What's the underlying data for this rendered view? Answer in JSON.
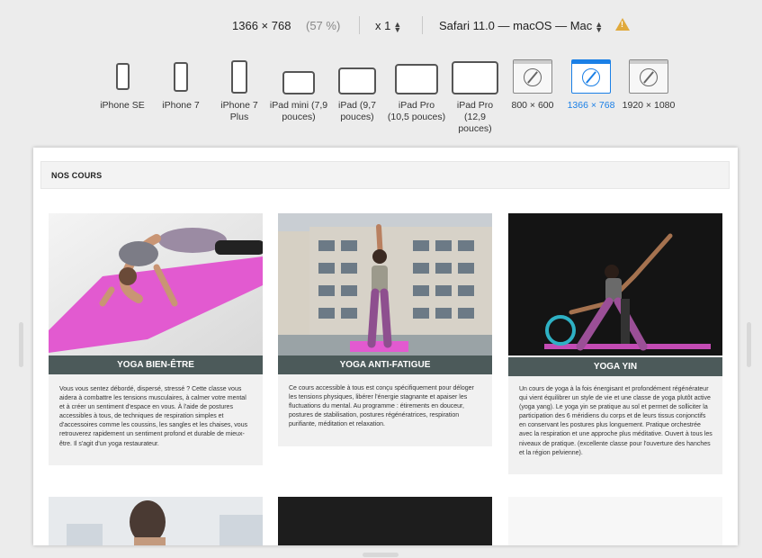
{
  "toolbar": {
    "dimensions": "1366 × 768",
    "percent": "(57 %)",
    "scale": "x 1",
    "browser": "Safari 11.0 — macOS — Mac"
  },
  "devices": [
    {
      "label": "iPhone SE",
      "icon": "phone-icon"
    },
    {
      "label": "iPhone 7",
      "icon": "phone-icon"
    },
    {
      "label": "iPhone 7 Plus",
      "icon": "phone-icon"
    },
    {
      "label": "iPad mini (7,9 pouces)",
      "icon": "tablet-icon"
    },
    {
      "label": "iPad (9,7 pouces)",
      "icon": "tablet-icon"
    },
    {
      "label": "iPad Pro (10,5 pouces)",
      "icon": "tablet-icon"
    },
    {
      "label": "iPad Pro (12,9 pouces)",
      "icon": "tablet-icon"
    },
    {
      "label": "800 × 600",
      "icon": "safari-compass-icon"
    },
    {
      "label": "1366 × 768",
      "icon": "safari-compass-icon",
      "active": true
    },
    {
      "label": "1920 × 1080",
      "icon": "safari-compass-icon"
    }
  ],
  "page": {
    "section_title": "NOS COURS",
    "cards": [
      {
        "title": "YOGA BIEN-ÊTRE",
        "text": "Vous vous sentez débordé, dispersé, stressé ? Cette classe vous aidera à combattre les tensions musculaires, à calmer votre mental et à créer un sentiment d'espace en vous. À l'aide de postures accessibles à tous, de techniques de respiration simples et d'accessoires comme les coussins, les sangles et les chaises, vous retrouverez rapidement un sentiment profond et durable de mieux- être. Il s'agit d'un yoga restaurateur."
      },
      {
        "title": "YOGA ANTI-FATIGUE",
        "text": "Ce cours accessible à tous est conçu spécifiquement pour déloger les tensions physiques, libérer l'énergie stagnante et apaiser les fluctuations du mental. Au programme : étirements en douceur, postures de stabilisation, postures régénératrices, respiration purifiante, méditation et relaxation."
      },
      {
        "title": "YOGA YIN",
        "text": "Un cours de yoga à la fois énergisant et profondément régénérateur qui vient équilibrer un style de vie et une classe de yoga plutôt active (yoga yang). Le yoga yin se pratique au sol et permet de solliciter la participation des 6 méridiens du corps et de leurs tissus conjonctifs en conservant les postures plus longuement. Pratique orchestrée avec la respiration et une approche plus méditative. Ouvert à tous les niveaux de pratique. (excellente classe pour l'ouverture des hanches et la région pelvienne)."
      }
    ]
  },
  "colors": {
    "accent": "#1a7fe6",
    "card_title_bg": "#4c5a5a",
    "mat_pink": "#e25ad0"
  }
}
